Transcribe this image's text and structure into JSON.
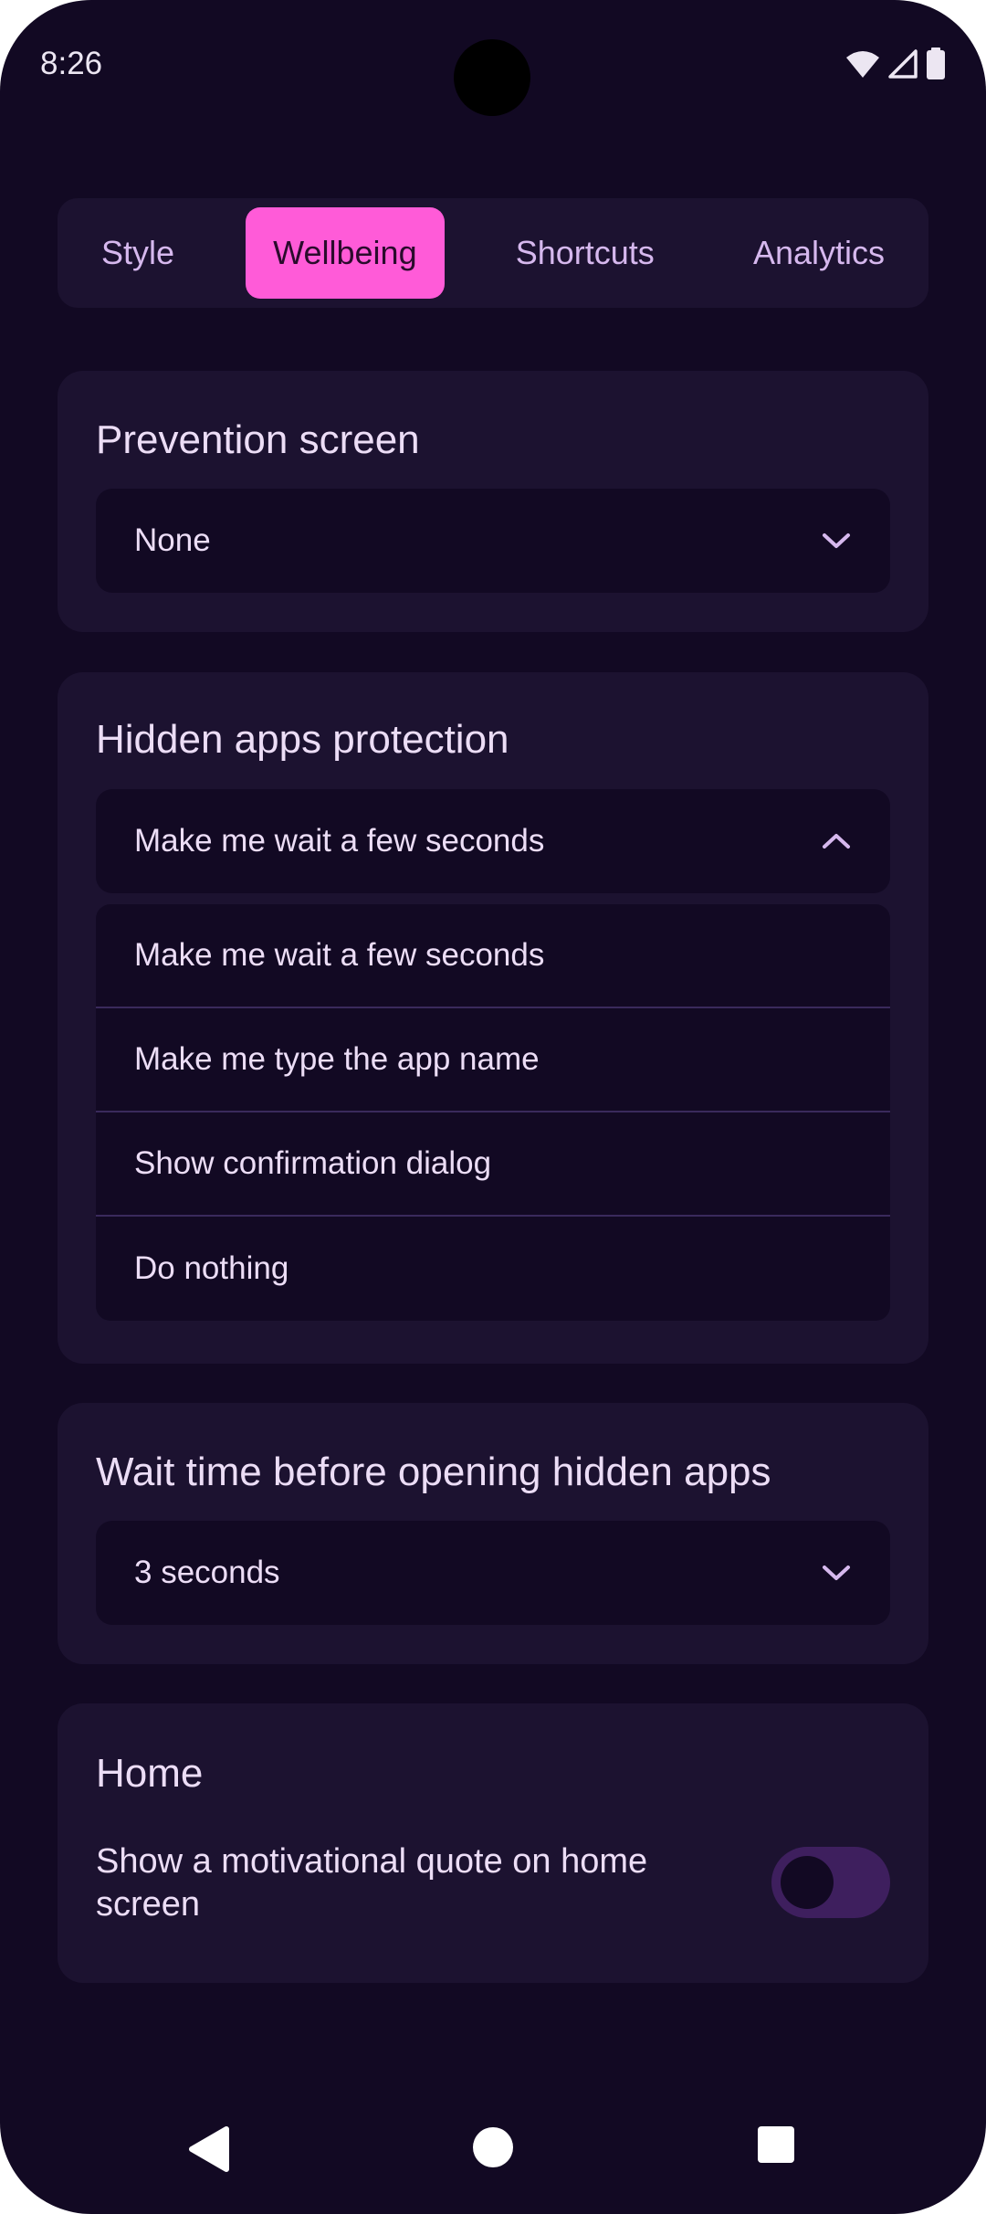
{
  "status_bar": {
    "time": "8:26",
    "icons": [
      "wifi-icon",
      "cell-signal-icon",
      "battery-icon"
    ]
  },
  "tabs": [
    {
      "label": "Style",
      "active": false
    },
    {
      "label": "Wellbeing",
      "active": true
    },
    {
      "label": "Shortcuts",
      "active": false
    },
    {
      "label": "Analytics",
      "active": false
    }
  ],
  "prevention": {
    "title": "Prevention screen",
    "value": "None"
  },
  "hidden_apps": {
    "title": "Hidden apps protection",
    "value": "Make me wait a few seconds",
    "options": [
      "Make me wait a few seconds",
      "Make me type the app name",
      "Show confirmation dialog",
      "Do nothing"
    ]
  },
  "wait_time": {
    "title": "Wait time before opening hidden apps",
    "value": "3 seconds"
  },
  "home": {
    "title": "Home",
    "quote_label": "Show a motivational quote on home screen",
    "quote_enabled": false
  },
  "colors": {
    "background": "#120923",
    "card": "#1C1230",
    "accent": "#FF5BD8",
    "text": "#ECDDF6"
  },
  "nav_bar": {
    "icons": [
      "back-icon",
      "home-icon",
      "recents-icon"
    ]
  }
}
